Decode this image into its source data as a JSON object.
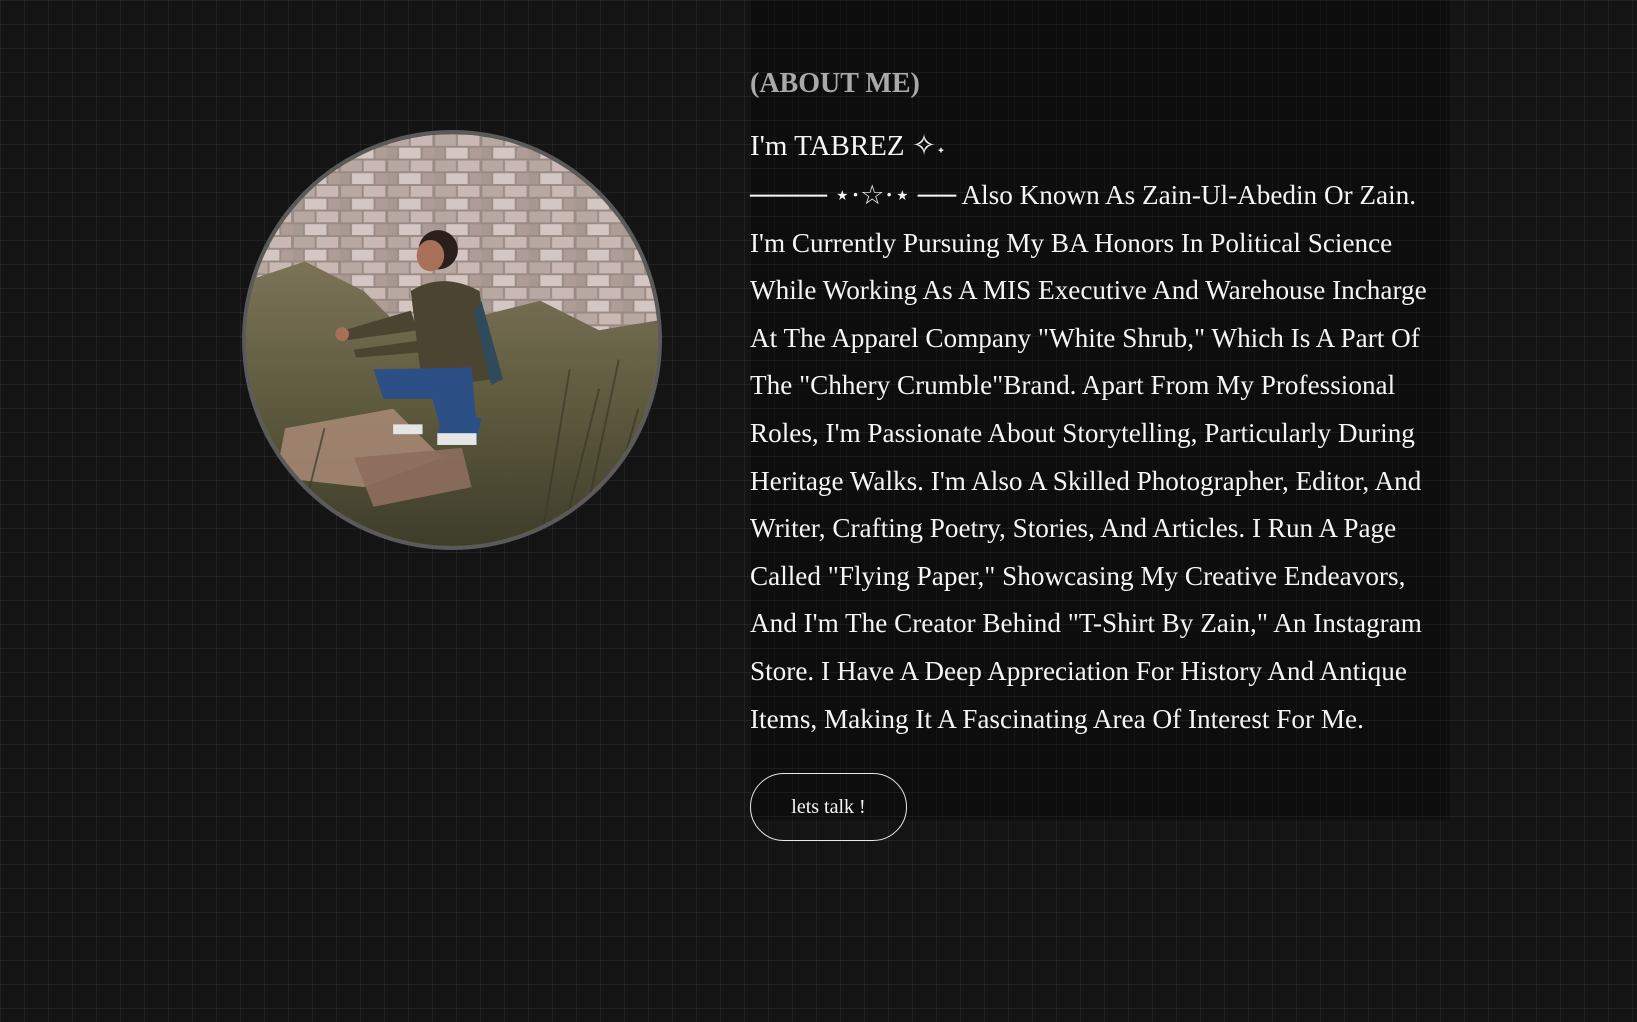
{
  "about": {
    "eyebrow": "(ABOUT ME)",
    "greeting": "I'm TABREZ ✧˖",
    "bio": "──── ⋆⋅☆⋅⋆ ── Also Known As Zain-Ul-Abedin Or Zain. I'm Currently Pursuing My BA Honors In Political Science While Working As A MIS Executive And Warehouse Incharge At The Apparel Company \"White Shrub,\" Which Is A Part Of The \"Chhery Crumble\"Brand. Apart From My Professional Roles, I'm Passionate About Storytelling, Particularly During Heritage Walks. I'm Also A Skilled Photographer, Editor, And Writer, Crafting Poetry, Stories, And Articles. I Run A Page Called \"Flying Paper,\" Showcasing My Creative Endeavors, And I'm The Creator Behind \"T-Shirt By Zain,\" An Instagram Store. I Have A Deep Appreciation For History And Antique Items, Making It A Fascinating Area Of Interest For Me.",
    "cta_label": "lets talk !"
  },
  "colors": {
    "background": "#141414",
    "text": "#f5f5f5",
    "eyebrow": "#a9a9a9",
    "photo_border": "#5a5a5a"
  }
}
